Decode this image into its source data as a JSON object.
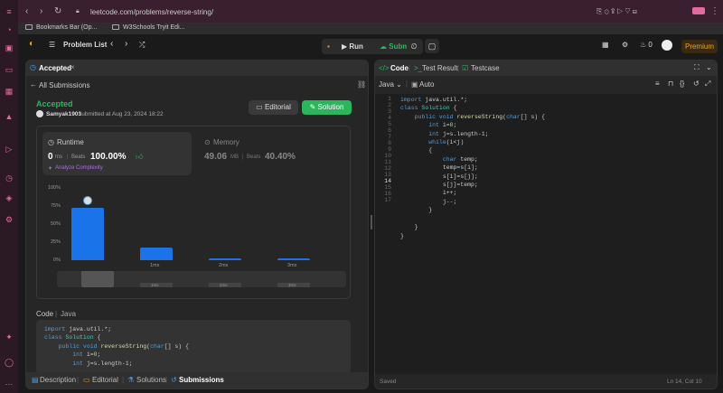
{
  "browser": {
    "url": "leetcode.com/problems/reverse-string/",
    "bookmarks": [
      "Bookmarks Bar (Op...",
      "W3Schools Tryit Edi..."
    ]
  },
  "topbar": {
    "problem_list": "Problem List",
    "run": "Run",
    "submit": "Submit",
    "streak": "0",
    "premium": "Premium"
  },
  "left": {
    "tab": "Accepted",
    "all_submissions": "All Submissions",
    "status": "Accepted",
    "user": "Samyak1903",
    "submitted": "submitted at Aug 23, 2024 18:22",
    "editorial_btn": "Editorial",
    "solution_btn": "Solution",
    "runtime_label": "Runtime",
    "runtime_value": "0",
    "runtime_unit": "ms",
    "beats": "Beats",
    "runtime_beats": "100.00%",
    "analyze": "Analyze Complexity",
    "memory_label": "Memory",
    "memory_value": "49.06",
    "memory_unit": "MB",
    "memory_beats": "40.40%",
    "code_label": "Code",
    "code_lang": "Java"
  },
  "chart_data": {
    "type": "bar",
    "yticks": [
      "100%",
      "75%",
      "50%",
      "25%",
      "0%"
    ],
    "categories": [
      "0ms",
      "1ms",
      "2ms",
      "3ms"
    ],
    "x_labels_shown": [
      "",
      "1ms",
      "2ms",
      "3ms"
    ],
    "values": [
      73,
      17,
      3,
      3
    ],
    "ylim": [
      0,
      100
    ]
  },
  "bottom_tabs": [
    "Description",
    "Editorial",
    "Solutions",
    "Submissions"
  ],
  "right": {
    "tab_code": "Code",
    "tab_test": "Test Result",
    "tab_case": "Testcase",
    "lang": "Java",
    "auto": "Auto",
    "status": "Saved",
    "cursor": "Ln 14, Col 10"
  }
}
